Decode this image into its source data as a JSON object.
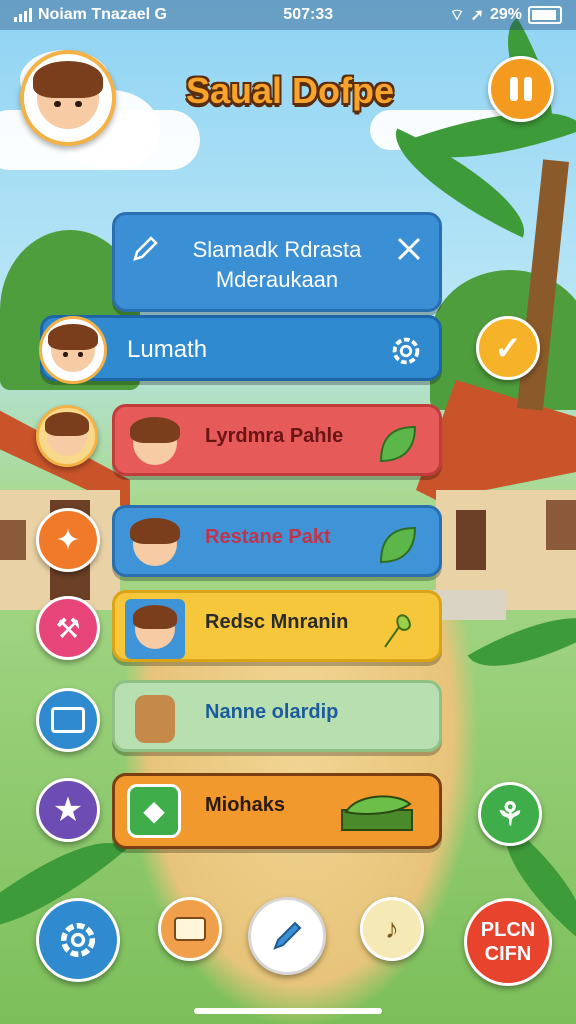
{
  "status_bar": {
    "carrier": "Noiam Tnazael G",
    "time": "507:33",
    "battery": "29%"
  },
  "header": {
    "title": "Saual Dofpe"
  },
  "panel_header": {
    "line1": "Slamadk Rdrasta",
    "line2": "Mderaukaan"
  },
  "profile_row": {
    "label": "Lumath"
  },
  "items": [
    {
      "label": "Lyrdmra Pahle",
      "color": "#e65a5a"
    },
    {
      "label": "Restane Pakt",
      "color": "#3f94d8"
    },
    {
      "label": "Redsc Mnranin",
      "color": "#f6c63b"
    },
    {
      "label": "Nanne olardip",
      "color": "#b7dfb0"
    },
    {
      "label": "Miohaks",
      "color": "#f2992d"
    }
  ],
  "bottom_bar": {
    "play_line1": "PLCN",
    "play_line2": "CIFN"
  },
  "icons": [
    "gear-icon",
    "check-icon",
    "star-icon",
    "wrench-icon",
    "briefcase-icon",
    "pencil-icon",
    "leaf-icon",
    "sound-icon",
    "pause-icon"
  ]
}
